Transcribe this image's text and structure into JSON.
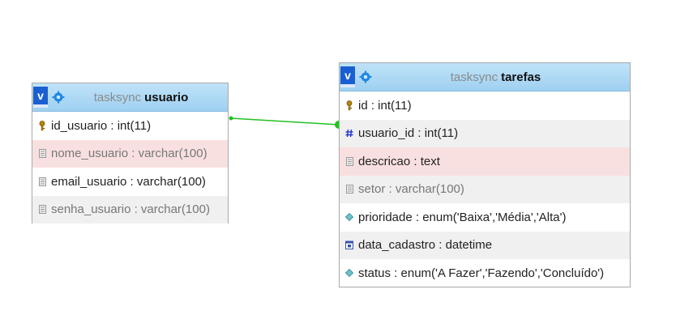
{
  "tables": {
    "usuario": {
      "schema": "tasksync",
      "name": "usuario",
      "toggle": "v",
      "columns": [
        {
          "text": "id_usuario : int(11)",
          "icon": "key-icon"
        },
        {
          "text": "nome_usuario : varchar(100)",
          "icon": "column-icon"
        },
        {
          "text": "email_usuario : varchar(100)",
          "icon": "column-icon"
        },
        {
          "text": "senha_usuario : varchar(100)",
          "icon": "column-icon"
        }
      ]
    },
    "tarefas": {
      "schema": "tasksync",
      "name": "tarefas",
      "toggle": "v",
      "columns": [
        {
          "text": "id : int(11)",
          "icon": "key-icon"
        },
        {
          "text": "usuario_id : int(11)",
          "icon": "hash-icon"
        },
        {
          "text": "descricao : text",
          "icon": "column-icon"
        },
        {
          "text": "setor : varchar(100)",
          "icon": "column-icon"
        },
        {
          "text": "prioridade : enum('Baixa','Média','Alta')",
          "icon": "enum-icon"
        },
        {
          "text": "data_cadastro : datetime",
          "icon": "date-icon"
        },
        {
          "text": "status : enum('A Fazer','Fazendo','Concluído')",
          "icon": "enum-icon"
        }
      ]
    }
  },
  "colors": {
    "relation_line": "#22c022",
    "header_accent": "#1a5fd1"
  }
}
